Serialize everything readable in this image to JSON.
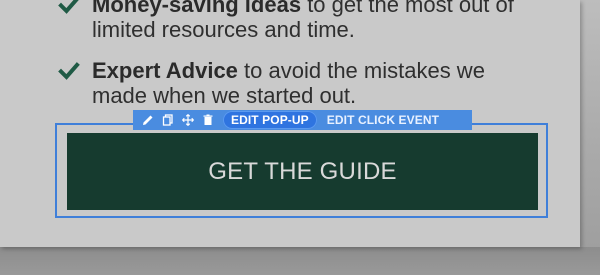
{
  "bullets": [
    {
      "bold": "Money-saving ideas",
      "rest": " to get the most out of limited resources and time."
    },
    {
      "bold": "Expert Advice",
      "rest": " to avoid the mistakes we made when we started out."
    }
  ],
  "toolbar": {
    "icons": [
      "pencil-icon",
      "copy-icon",
      "move-icon",
      "trash-icon"
    ],
    "edit_popup_label": "EDIT POP-UP",
    "edit_click_event_label": "EDIT CLICK EVENT"
  },
  "cta": {
    "label": "GET THE GUIDE"
  },
  "colors": {
    "check": "#1f5a45",
    "button_bg": "#163b2f",
    "edit_accent": "#4a8ce0"
  }
}
